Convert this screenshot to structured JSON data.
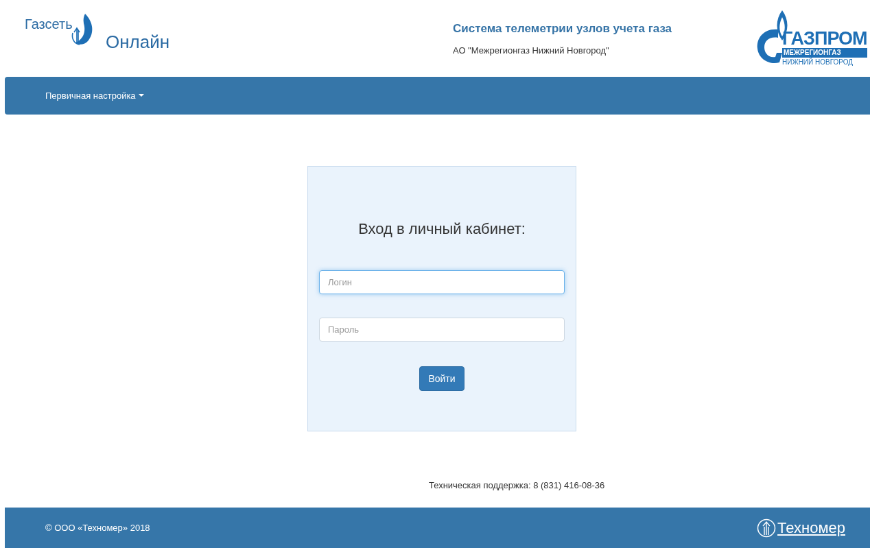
{
  "header": {
    "logo": {
      "word_top": "Газсеть",
      "word_bottom": "Онлайн"
    },
    "title": "Система телеметрии узлов учета газа",
    "subtitle": "АО \"Межрегионгаз Нижний Новгород\"",
    "partner_logo": {
      "line_1": "ГАЗПРОМ",
      "line_2": "МЕЖРЕГИОНГАЗ",
      "line_3": "НИЖНИЙ НОВГОРОД"
    }
  },
  "navbar": {
    "items": [
      {
        "label": "Первичная настройка",
        "dropdown": true
      }
    ]
  },
  "login": {
    "title": "Вход в личный кабинет:",
    "fields": [
      {
        "placeholder": "Логин",
        "focused": true
      },
      {
        "placeholder": "Пароль",
        "focused": false
      }
    ],
    "button": "Войти"
  },
  "support": "Техническая поддержка: 8 (831) 416-08-36",
  "footer": {
    "copyright": "© ООО «Техномер» 2018",
    "brand": "Техномер"
  }
}
